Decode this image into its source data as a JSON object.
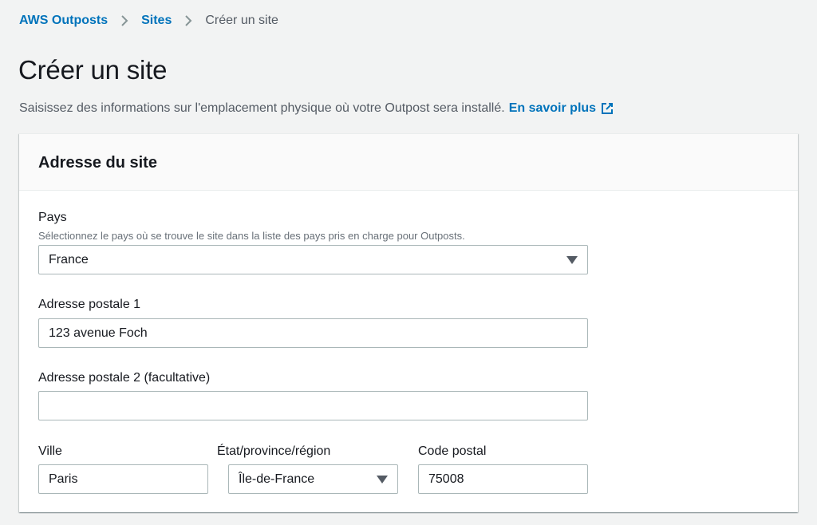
{
  "breadcrumb": {
    "items": [
      {
        "label": "AWS Outposts"
      },
      {
        "label": "Sites"
      },
      {
        "label": "Créer un site"
      }
    ]
  },
  "page": {
    "title": "Créer un site",
    "description": "Saisissez des informations sur l'emplacement physique où votre Outpost sera installé.",
    "learn_more": "En savoir plus"
  },
  "form": {
    "section_title": "Adresse du site",
    "country": {
      "label": "Pays",
      "hint": "Sélectionnez le pays où se trouve le site dans la liste des pays pris en charge pour Outposts.",
      "value": "France"
    },
    "address1": {
      "label": "Adresse postale 1",
      "value": "123 avenue Foch"
    },
    "address2": {
      "label": "Adresse postale 2 (facultative)",
      "value": ""
    },
    "city": {
      "label": "Ville",
      "value": "Paris"
    },
    "state": {
      "label": "État/province/région",
      "value": "Île-de-France"
    },
    "postal_code": {
      "label": "Code postal",
      "value": "75008"
    }
  },
  "icons": {
    "separator": "chevron-right-icon",
    "external": "external-link-icon",
    "dropdown": "caret-down-icon"
  },
  "colors": {
    "link": "#0073bb",
    "text": "#16191f",
    "muted": "#545b64",
    "background": "#f2f3f3",
    "border": "#aab7b8"
  }
}
